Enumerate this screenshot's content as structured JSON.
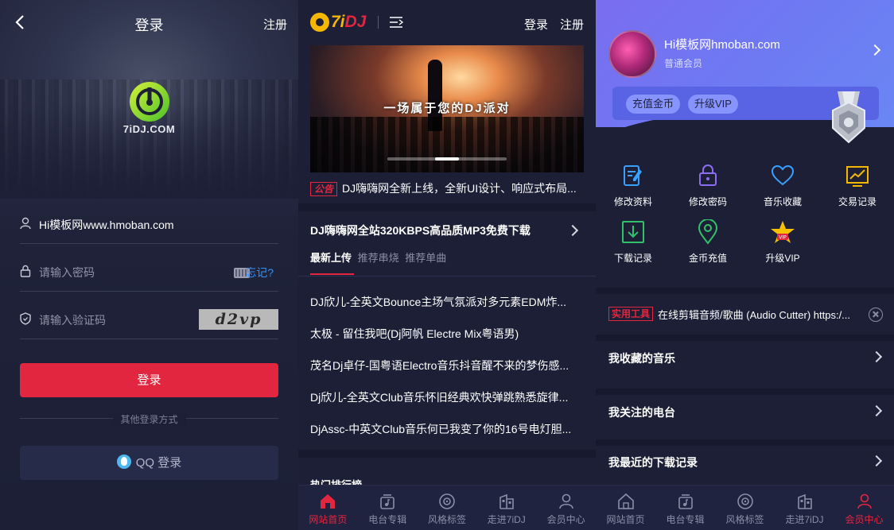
{
  "login": {
    "title": "登录",
    "register": "注册",
    "logo_text": "7iDJ.COM",
    "username_value": "Hi模板网www.hmoban.com",
    "password_placeholder": "请输入密码",
    "forgot": "忘记?",
    "captcha_placeholder": "请输入验证码",
    "captcha_code": "d2vp",
    "login_button": "登录",
    "other_methods": "其他登录方式",
    "qq_button": "QQ 登录"
  },
  "home": {
    "logo_word_main": "7i",
    "logo_word_accent": "DJ",
    "login": "登录",
    "register": "注册",
    "banner_caption": "一场属于您的DJ派对",
    "notice_tag": "公告",
    "notice_text": "DJ嗨嗨网全新上线，全新UI设计、响应式布局...",
    "download_header": "DJ嗨嗨网全站320KBPS高品质MP3免费下载",
    "tabs": [
      "最新上传",
      "推荐串烧",
      "推荐单曲"
    ],
    "songs": [
      "DJ欣儿-全英文Bounce主场气氛派对多元素EDM炸...",
      "太极 - 留住我吧(Dj阿帆 Electre Mix粤语男)",
      "茂名Dj卓仔-国粤语Electro音乐抖音醒不来的梦伤感...",
      "Dj欣儿-全英文Club音乐怀旧经典欢快弹跳熟悉旋律...",
      "DjAssc-中英文Club音乐何已我变了你的16号电灯胆..."
    ],
    "hot_header": "热门排行榜"
  },
  "member": {
    "username": "Hi模板网hmoban.com",
    "level": "普通会员",
    "recharge": "充值金币",
    "upgrade": "升级VIP",
    "grid": [
      "修改资料",
      "修改密码",
      "音乐收藏",
      "交易记录",
      "下载记录",
      "金币充值",
      "升级VIP"
    ],
    "tool_tag": "实用工具",
    "tool_text": "在线剪辑音频/歌曲 (Audio Cutter) https:/...",
    "rows": [
      "我收藏的音乐",
      "我关注的电台",
      "我最近的下载记录"
    ]
  },
  "tabbar": [
    "网站首页",
    "电台专辑",
    "风格标签",
    "走进7iDJ",
    "会员中心"
  ],
  "colors": {
    "accent": "#e3263f",
    "background": "#1c1f36",
    "link": "#3b8ff0",
    "member_gradient": "#7a6df0"
  }
}
